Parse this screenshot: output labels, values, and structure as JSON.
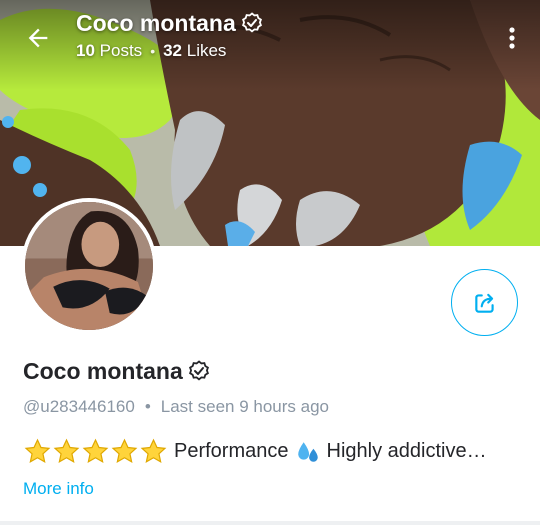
{
  "header": {
    "name": "Coco montana",
    "posts_count": "10",
    "posts_label": "Posts",
    "likes_count": "32",
    "likes_label": "Likes"
  },
  "profile": {
    "name": "Coco montana",
    "handle": "@u283446160",
    "last_seen": "Last seen 9 hours ago",
    "bio_text": "Performance",
    "bio_text_2": "Highly addictive…",
    "more_info": "More info",
    "star_rating": 5
  },
  "colors": {
    "accent": "#00aff0",
    "text": "#242529",
    "muted": "#8a96a3"
  },
  "icons": [
    "back-arrow-icon",
    "verified-badge-icon",
    "more-vertical-icon",
    "share-icon",
    "star-icon",
    "sweat-droplets-icon"
  ]
}
